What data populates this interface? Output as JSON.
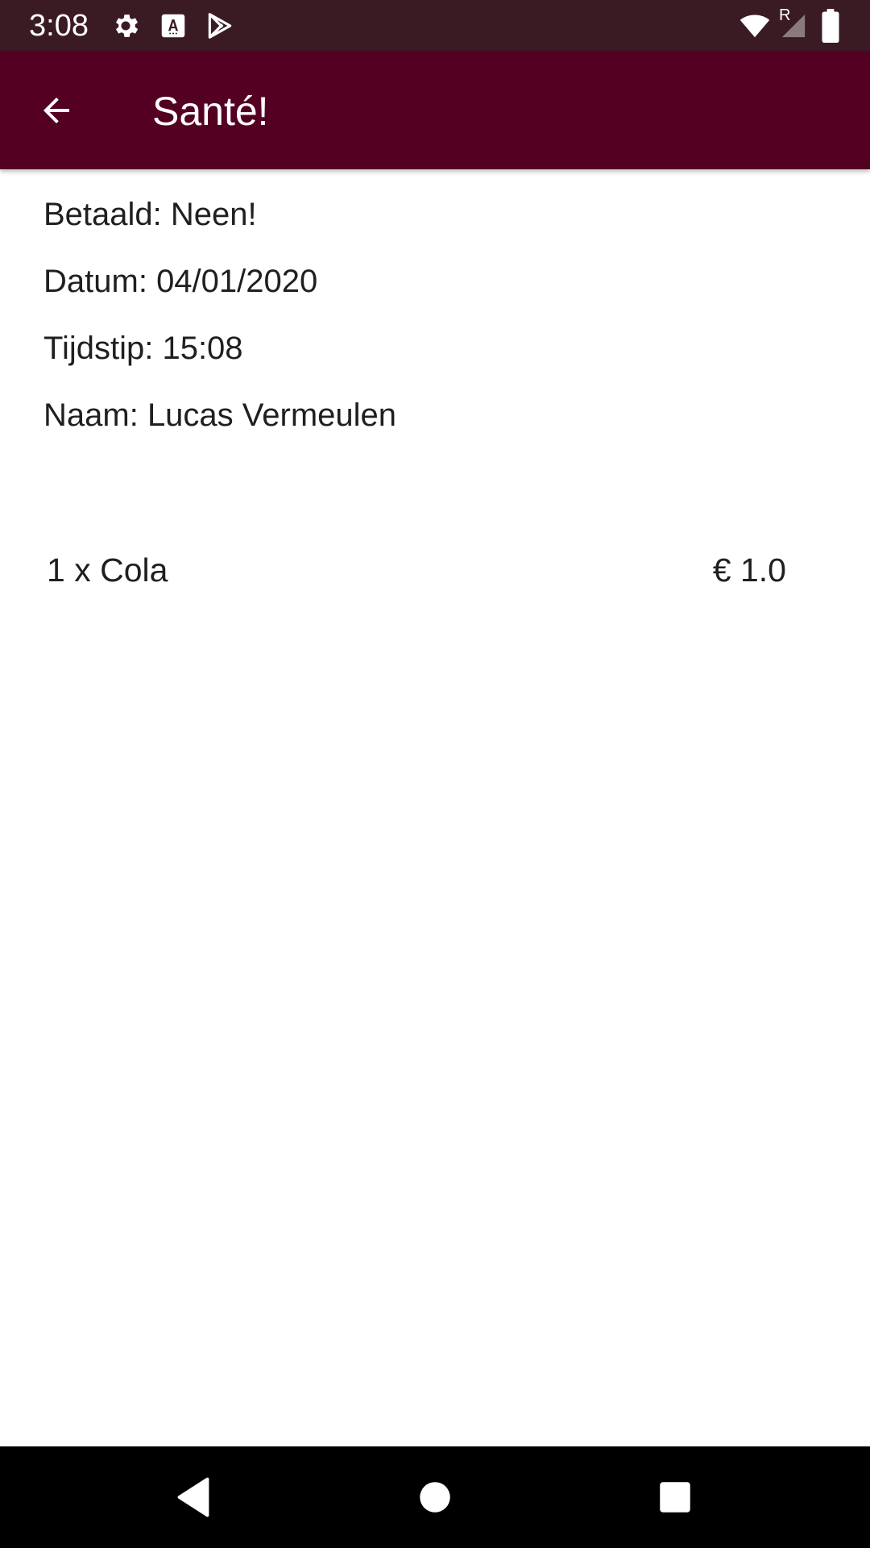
{
  "status_bar": {
    "time": "3:08",
    "indicator": "R",
    "icons": [
      "gear-icon",
      "text-a-icon",
      "play-store-icon",
      "wifi-icon",
      "signal-icon",
      "battery-icon"
    ]
  },
  "app_bar": {
    "title": "Santé!",
    "back_icon": "arrow-left-icon",
    "background_color": "#540022"
  },
  "details": {
    "paid": {
      "label": "Betaald:",
      "value": "Neen!"
    },
    "date": {
      "label": "Datum:",
      "value": "04/01/2020"
    },
    "time": {
      "label": "Tijdstip:",
      "value": "15:08"
    },
    "name": {
      "label": "Naam:",
      "value": "Lucas Vermeulen"
    }
  },
  "order": {
    "items": [
      {
        "description": "1 x Cola",
        "price": "€ 1.0"
      }
    ]
  },
  "nav_bar": {
    "buttons": [
      "back-triangle-icon",
      "home-circle-icon",
      "recents-square-icon"
    ]
  }
}
